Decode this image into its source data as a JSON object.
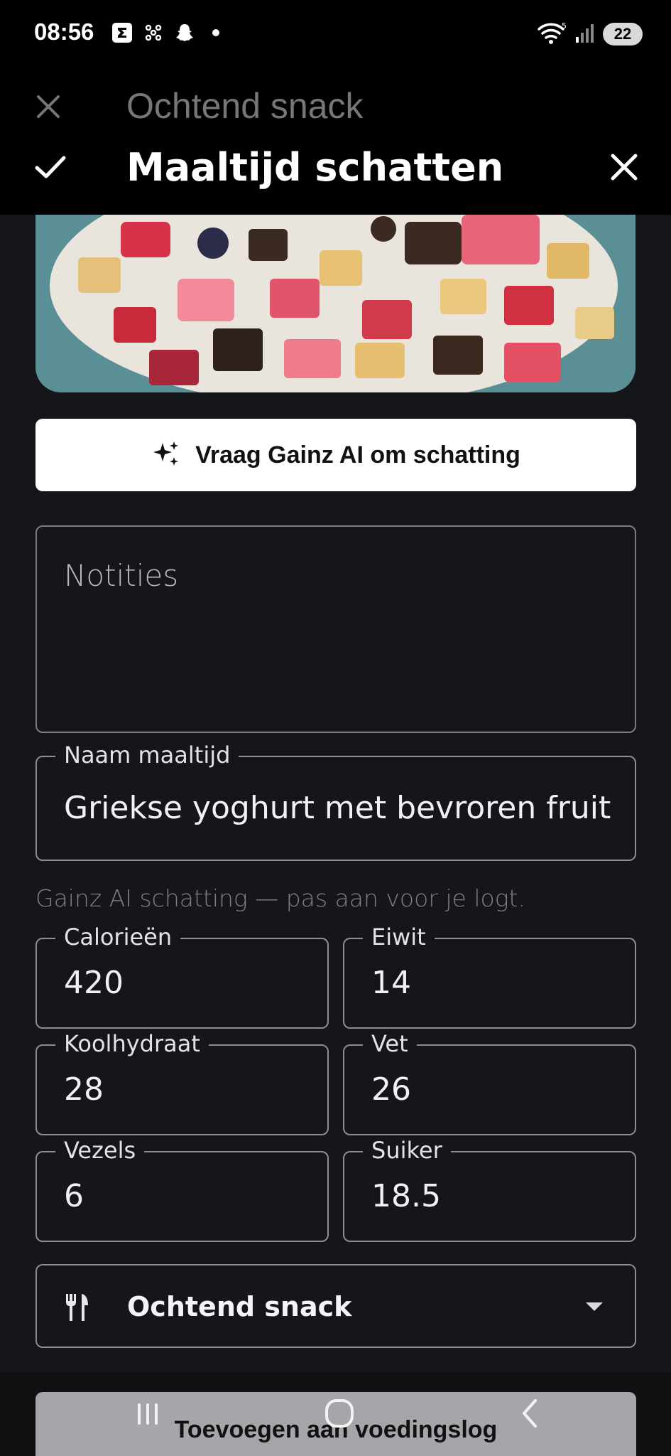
{
  "status_bar": {
    "time": "08:56",
    "battery": "22",
    "icons": [
      "sigma-app-icon",
      "flower-app-icon",
      "snapchat-icon",
      "dot-icon",
      "wifi-icon",
      "signal-icon",
      "battery-icon"
    ]
  },
  "underlying": {
    "title": "Ochtend snack"
  },
  "dialog": {
    "title": "Maaltijd schatten",
    "ai_button_label": "Vraag Gainz AI om schatting",
    "notes_placeholder": "Notities",
    "meal_name": {
      "label": "Naam maaltijd",
      "value": "Griekse yoghurt met bevroren fruit"
    },
    "hint": "Gainz AI schatting — pas aan voor je logt.",
    "macros": [
      {
        "label": "Calorieën",
        "value": "420"
      },
      {
        "label": "Eiwit",
        "value": "14"
      },
      {
        "label": "Koolhydraat",
        "value": "28"
      },
      {
        "label": "Vet",
        "value": "26"
      },
      {
        "label": "Vezels",
        "value": "6"
      },
      {
        "label": "Suiker",
        "value": "18.5"
      }
    ],
    "meal_type": "Ochtend snack",
    "submit_label": "Toevoegen aan voedingslog"
  },
  "colors": {
    "background": "#151619",
    "header": "#000000",
    "ai_button": "#ffffff",
    "submit_button": "#a5a6a9",
    "border": "#8c8e93"
  }
}
